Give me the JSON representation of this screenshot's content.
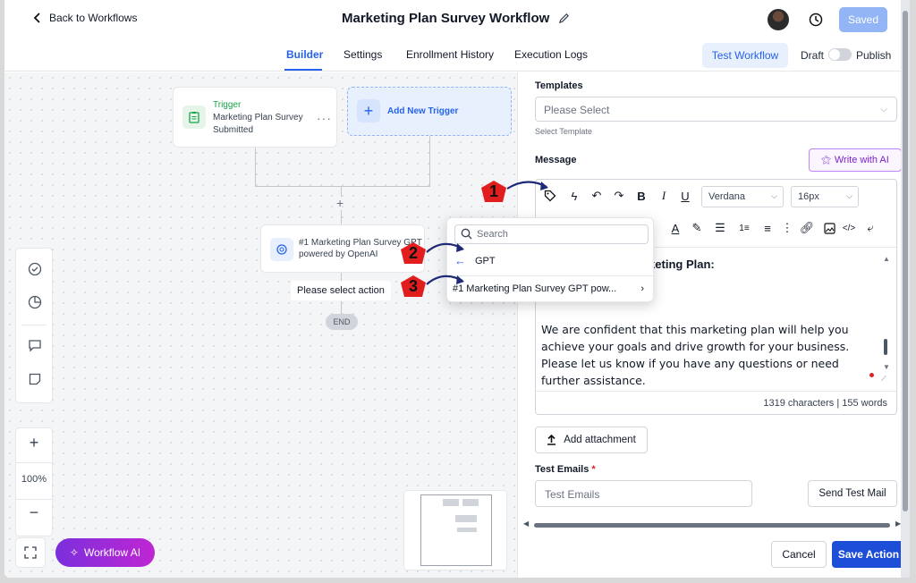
{
  "header": {
    "back_label": "Back to Workflows",
    "title": "Marketing Plan Survey Workflow",
    "saved_label": "Saved"
  },
  "tabs": [
    {
      "label": "Builder",
      "active": true
    },
    {
      "label": "Settings"
    },
    {
      "label": "Enrollment History"
    },
    {
      "label": "Execution Logs"
    }
  ],
  "actions": {
    "test_workflow": "Test Workflow",
    "draft": "Draft",
    "publish": "Publish"
  },
  "canvas": {
    "trigger": {
      "label": "Trigger",
      "text": "Marketing Plan Survey Submitted"
    },
    "add_trigger": "Add New Trigger",
    "gpt_node": "#1 Marketing Plan Survey GPT powered by OpenAI",
    "select_action": "Please select action",
    "end": "END",
    "zoom_level": "100%",
    "workflow_ai": "Workflow AI"
  },
  "panel": {
    "templates_label": "Templates",
    "templates_placeholder": "Please Select",
    "templates_hint": "Select Template",
    "message_label": "Message",
    "write_ai": "Write with AI",
    "font": "Verdana",
    "font_size": "16px",
    "heading": "rketing Plan:",
    "body": "We are confident that this marketing plan will help you achieve your goals and drive growth for your business. Please let us know if you have any questions or need further assistance.",
    "count": "1319 characters | 155 words",
    "add_attachment": "Add attachment",
    "test_emails_label": "Test Emails",
    "test_emails_required": "*",
    "test_emails_placeholder": "Test Emails",
    "send_test": "Send Test Mail",
    "cancel": "Cancel",
    "save": "Save Action"
  },
  "dropdown": {
    "search_placeholder": "Search",
    "back_item": "GPT",
    "item": "#1 Marketing Plan Survey GPT pow..."
  },
  "markers": [
    "1",
    "2",
    "3"
  ],
  "colors": {
    "accent": "#2563eb",
    "marker": "#e11d1d",
    "ai_gradient_start": "#7b2fdc",
    "ai_gradient_end": "#c026d3"
  }
}
